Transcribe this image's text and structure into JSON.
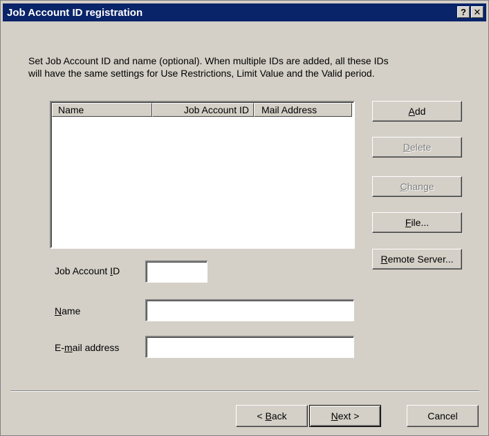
{
  "window": {
    "title": "Job Account ID registration",
    "help_label": "?",
    "close_label": "✕"
  },
  "description": "Set Job Account ID and name (optional). When multiple IDs are added, all these IDs\nwill have the same settings for Use Restrictions, Limit Value and the Valid period.",
  "list": {
    "columns": [
      "Name",
      "Job Account ID",
      "Mail Address"
    ],
    "rows": []
  },
  "side_buttons": {
    "add": {
      "mnemonic": "A",
      "rest": "dd"
    },
    "delete": {
      "mnemonic": "D",
      "rest": "elete"
    },
    "change": {
      "mnemonic": "C",
      "rest": "hange"
    },
    "file": {
      "mnemonic": "F",
      "rest": "ile..."
    },
    "remote": {
      "mnemonic": "R",
      "rest": "emote Server..."
    }
  },
  "form": {
    "job_account_id": {
      "label_pre": "Job Account ",
      "mnemonic": "I",
      "label_post": "D",
      "value": ""
    },
    "name": {
      "label_pre": "",
      "mnemonic": "N",
      "label_post": "ame",
      "value": ""
    },
    "email": {
      "label_pre": "E-",
      "mnemonic": "m",
      "label_post": "ail address",
      "value": ""
    }
  },
  "footer": {
    "back": {
      "pre": "< ",
      "mnemonic": "B",
      "post": "ack"
    },
    "next": {
      "pre": "",
      "mnemonic": "N",
      "post": "ext >"
    },
    "cancel": "Cancel"
  },
  "colors": {
    "title_bar": "#0a246a",
    "face": "#d4d0c8",
    "disabled_text": "#808080"
  }
}
